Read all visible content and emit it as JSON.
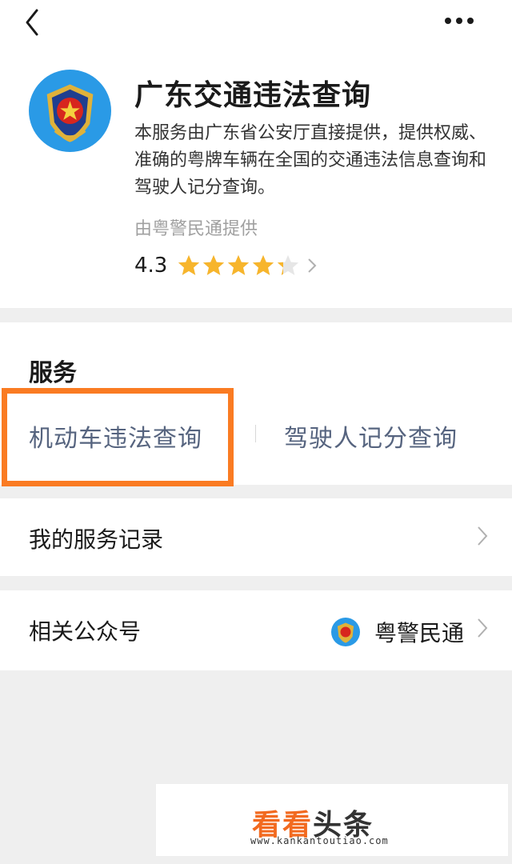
{
  "header": {
    "title": "广东交通违法查询",
    "description": "本服务由广东省公安厅直接提供，提供权威、准确的粤牌车辆在全国的交通违法信息查询和驾驶人记分查询。",
    "provider": "由粤警民通提供",
    "rating": "4.3",
    "stars_filled": 4.3,
    "stars_max": 5
  },
  "services": {
    "section_title": "服务",
    "items": [
      "机动车违法查询",
      "驾驶人记分查询"
    ],
    "highlight_color": "#fa7b22"
  },
  "records": {
    "label": "我的服务记录"
  },
  "related": {
    "label": "相关公众号",
    "account_name": "粤警民通"
  },
  "watermark": {
    "brand_part1": "看看",
    "brand_part2": "头条",
    "url": "www.kankantoutiao.com"
  },
  "colors": {
    "star": "#f7b52c",
    "service_text": "#56647f",
    "emblem_bg": "#2a9ae6"
  },
  "icons": [
    "back-icon",
    "more-icon",
    "police-emblem-icon",
    "star-icon",
    "chevron-right-icon"
  ]
}
